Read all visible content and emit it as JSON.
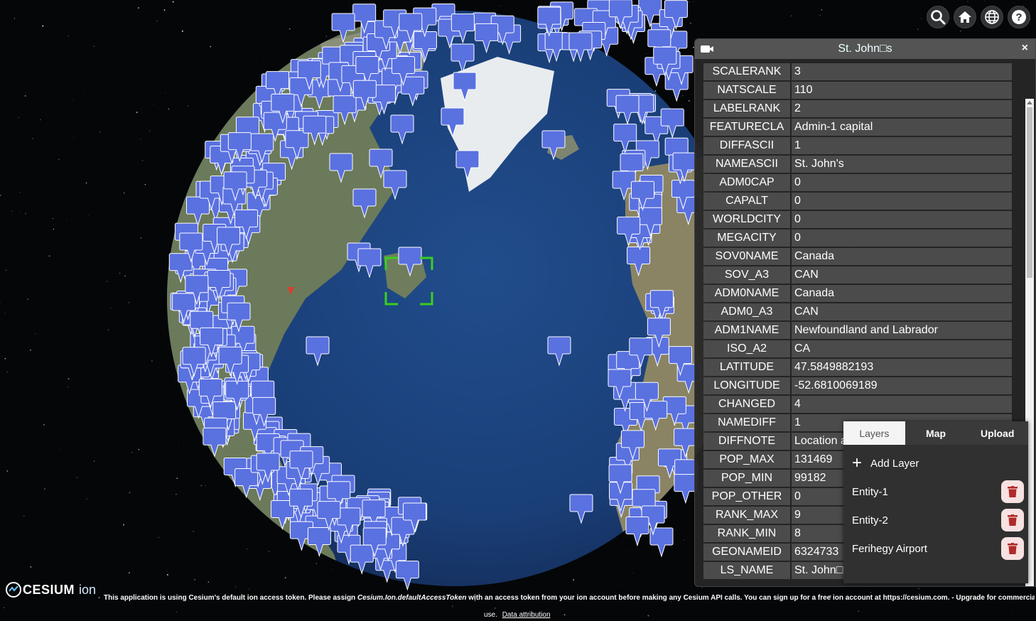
{
  "toolbar": {
    "buttons": [
      {
        "icon": "search-icon"
      },
      {
        "icon": "home-icon"
      },
      {
        "icon": "globe-icon"
      },
      {
        "icon": "help-icon"
      }
    ]
  },
  "infobox": {
    "title": "St. John□s",
    "close_label": "×",
    "properties": [
      {
        "key": "SCALERANK",
        "value": "3"
      },
      {
        "key": "NATSCALE",
        "value": "110"
      },
      {
        "key": "LABELRANK",
        "value": "2"
      },
      {
        "key": "FEATURECLA",
        "value": "Admin-1 capital"
      },
      {
        "key": "DIFFASCII",
        "value": "1"
      },
      {
        "key": "NAMEASCII",
        "value": "St. John's"
      },
      {
        "key": "ADM0CAP",
        "value": "0"
      },
      {
        "key": "CAPALT",
        "value": "0"
      },
      {
        "key": "WORLDCITY",
        "value": "0"
      },
      {
        "key": "MEGACITY",
        "value": "0"
      },
      {
        "key": "SOV0NAME",
        "value": "Canada"
      },
      {
        "key": "SOV_A3",
        "value": "CAN"
      },
      {
        "key": "ADM0NAME",
        "value": "Canada"
      },
      {
        "key": "ADM0_A3",
        "value": "CAN"
      },
      {
        "key": "ADM1NAME",
        "value": "Newfoundland and Labrador"
      },
      {
        "key": "ISO_A2",
        "value": "CA"
      },
      {
        "key": "LATITUDE",
        "value": "47.5849882193"
      },
      {
        "key": "LONGITUDE",
        "value": "-52.6810069189"
      },
      {
        "key": "CHANGED",
        "value": "4"
      },
      {
        "key": "NAMEDIFF",
        "value": "1"
      },
      {
        "key": "DIFFNOTE",
        "value": "Location a"
      },
      {
        "key": "POP_MAX",
        "value": "131469"
      },
      {
        "key": "POP_MIN",
        "value": "99182"
      },
      {
        "key": "POP_OTHER",
        "value": "0"
      },
      {
        "key": "RANK_MAX",
        "value": "9"
      },
      {
        "key": "RANK_MIN",
        "value": "8"
      },
      {
        "key": "GEONAMEID",
        "value": "6324733"
      },
      {
        "key": "LS_NAME",
        "value": "St. John□s"
      }
    ]
  },
  "layers_panel": {
    "tabs": [
      {
        "label": "Layers",
        "active": true
      },
      {
        "label": "Map",
        "active": false
      },
      {
        "label": "Upload",
        "active": false
      }
    ],
    "add_layer_label": "Add Layer",
    "entities": [
      {
        "label": "Entity-1"
      },
      {
        "label": "Entity-2"
      },
      {
        "label": "Ferihegy Airport"
      }
    ]
  },
  "credits": {
    "logo_text": "CESIUM",
    "logo_suffix": "ion",
    "message_prefix": "This application is using Cesium's default ion access token. Please assign ",
    "message_token": "Cesium.Ion.defaultAccessToken",
    "message_suffix": " with an access token from your ion account before making any Cesium API calls. You can sign up for a free ion account at https://cesium.com. - Upgrade for commercial",
    "message_line2": "use.",
    "data_attribution": "Data attribution"
  },
  "colors": {
    "marker": "#5a71e0",
    "ocean": "#1a3f78",
    "selection": "#39d01f",
    "delete_icon": "#b02a2a"
  }
}
